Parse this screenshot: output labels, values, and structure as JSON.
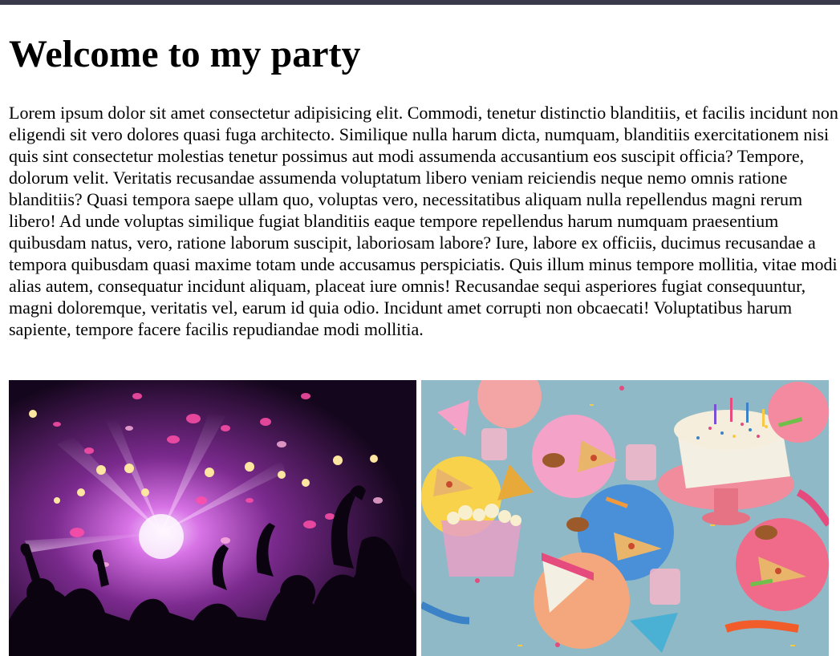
{
  "page": {
    "title": "Welcome to my party",
    "paragraph": "Lorem ipsum dolor sit amet consectetur adipisicing elit. Commodi, tenetur distinctio blanditiis, et facilis incidunt non eligendi sit vero dolores quasi fuga architecto. Similique nulla harum dicta, numquam, blanditiis exercitationem nisi quis sint consectetur molestias tenetur possimus aut modi assumenda accusantium eos suscipit officia? Tempore, dolorum velit. Veritatis recusandae assumenda voluptatum libero veniam reiciendis neque nemo omnis ratione blanditiis? Quasi tempora saepe ullam quo, voluptas vero, necessitatibus aliquam nulla repellendus magni rerum libero! Ad unde voluptas similique fugiat blanditiis eaque tempore repellendus harum numquam praesentium quibusdam natus, vero, ratione laborum suscipit, laboriosam labore? Iure, labore ex officiis, ducimus recusandae a tempora quibusdam quasi maxime totam unde accusamus perspiciatis. Quis illum minus tempore mollitia, vitae modi alias autem, consequatur incidunt aliquam, placeat iure omnis! Recusandae sequi asperiores fugiat consequuntur, magni doloremque, veritatis vel, earum id quia odio. Incidunt amet corrupti non obcaecati! Voluptatibus harum sapiente, tempore facere facilis repudiandae modi mollitia."
  },
  "colors": {
    "topbar": "#3a3b4a",
    "text": "#000000",
    "background": "#ffffff"
  }
}
